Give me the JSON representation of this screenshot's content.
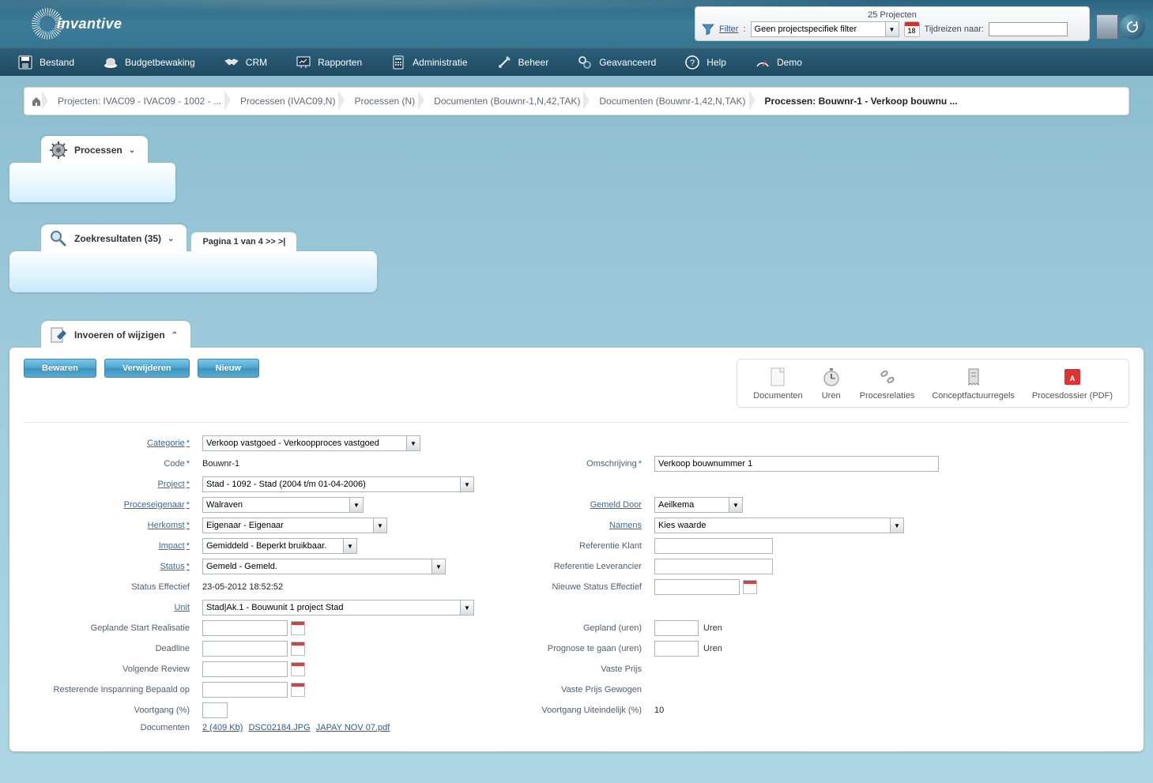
{
  "header": {
    "logo_text": "invantive",
    "projecten_count": "25 Projecten",
    "filter_label": "Filter",
    "filter_value": "Geen projectspecifiek filter",
    "cal_number": "18",
    "tijdreizen_label": "Tijdreizen naar:"
  },
  "menu": [
    {
      "label": "Bestand",
      "icon": "save-disk"
    },
    {
      "label": "Budgetbewaking",
      "icon": "hat"
    },
    {
      "label": "CRM",
      "icon": "handshake"
    },
    {
      "label": "Rapporten",
      "icon": "chart-board"
    },
    {
      "label": "Administratie",
      "icon": "calculator"
    },
    {
      "label": "Beheer",
      "icon": "tools"
    },
    {
      "label": "Geavanceerd",
      "icon": "gears"
    },
    {
      "label": "Help",
      "icon": "question"
    },
    {
      "label": "Demo",
      "icon": "gauge"
    }
  ],
  "breadcrumb": [
    "Projecten: IVAC09 - IVAC09 - 1002 - ...",
    "Processen (IVAC09,N)",
    "Processen (N)",
    "Documenten (Bouwnr-1,N,42,TAK)",
    "Documenten (Bouwnr-1,42,N,TAK)",
    "Processen: Bouwnr-1 - Verkoop bouwnu ..."
  ],
  "processen_tab": "Processen",
  "zoek_tab": "Zoekresultaten (35)",
  "pagination": "Pagina 1 van 4 >> >|",
  "form_tab": "Invoeren of wijzigen",
  "buttons": {
    "bewaren": "Bewaren",
    "verwijderen": "Verwijderen",
    "nieuw": "Nieuw"
  },
  "quicklinks": {
    "documenten": "Documenten",
    "uren": "Uren",
    "procesrelaties": "Procesrelaties",
    "conceptfactuurregels": "Conceptfactuurregels",
    "procesdossier": "Procesdossier (PDF)"
  },
  "labels": {
    "categorie": "Categorie",
    "code": "Code",
    "omschrijving": "Omschrijving",
    "project": "Project",
    "proceseigenaar": "Proceseigenaar",
    "gemeld_door": "Gemeld Door",
    "herkomst": "Herkomst",
    "namens": "Namens",
    "impact": "Impact",
    "referentie_klant": "Referentie Klant",
    "status": "Status",
    "referentie_leverancier": "Referentie Leverancier",
    "status_effectief": "Status Effectief",
    "nieuwe_status_effectief": "Nieuwe Status Effectief",
    "unit": "Unit",
    "geplande_start": "Geplande Start Realisatie",
    "gepland_uren": "Gepland (uren)",
    "deadline": "Deadline",
    "prognose": "Prognose te gaan (uren)",
    "volgende_review": "Volgende Review",
    "vaste_prijs": "Vaste Prijs",
    "resterende": "Resterende Inspanning Bepaald op",
    "vaste_prijs_gewogen": "Vaste Prijs Gewogen",
    "voortgang": "Voortgang (%)",
    "voortgang_uiteindelijk": "Voortgang Uiteindelijk (%)",
    "documenten": "Documenten",
    "uren_unit": "Uren"
  },
  "values": {
    "categorie": "Verkoop vastgoed - Verkoopproces vastgoed",
    "code": "Bouwnr-1",
    "omschrijving": "Verkoop bouwnummer 1",
    "project": "Stad - 1092 - Stad (2004 t/m 01-04-2006)",
    "proceseigenaar": "Walraven",
    "gemeld_door": "Aeilkema",
    "herkomst": "Eigenaar - Eigenaar",
    "namens": "Kies waarde",
    "impact": "Gemiddeld - Beperkt bruikbaar.",
    "status": "Gemeld - Gemeld.",
    "status_effectief": "23-05-2012 18:52:52",
    "unit": "Stad|Ak.1 - Bouwunit 1 project Stad",
    "voortgang_uiteindelijk": "10",
    "doc_link1": "2 (409 Kb)",
    "doc_link2": "DSC02184.JPG",
    "doc_link3": "JAPAY NOV 07.pdf"
  }
}
